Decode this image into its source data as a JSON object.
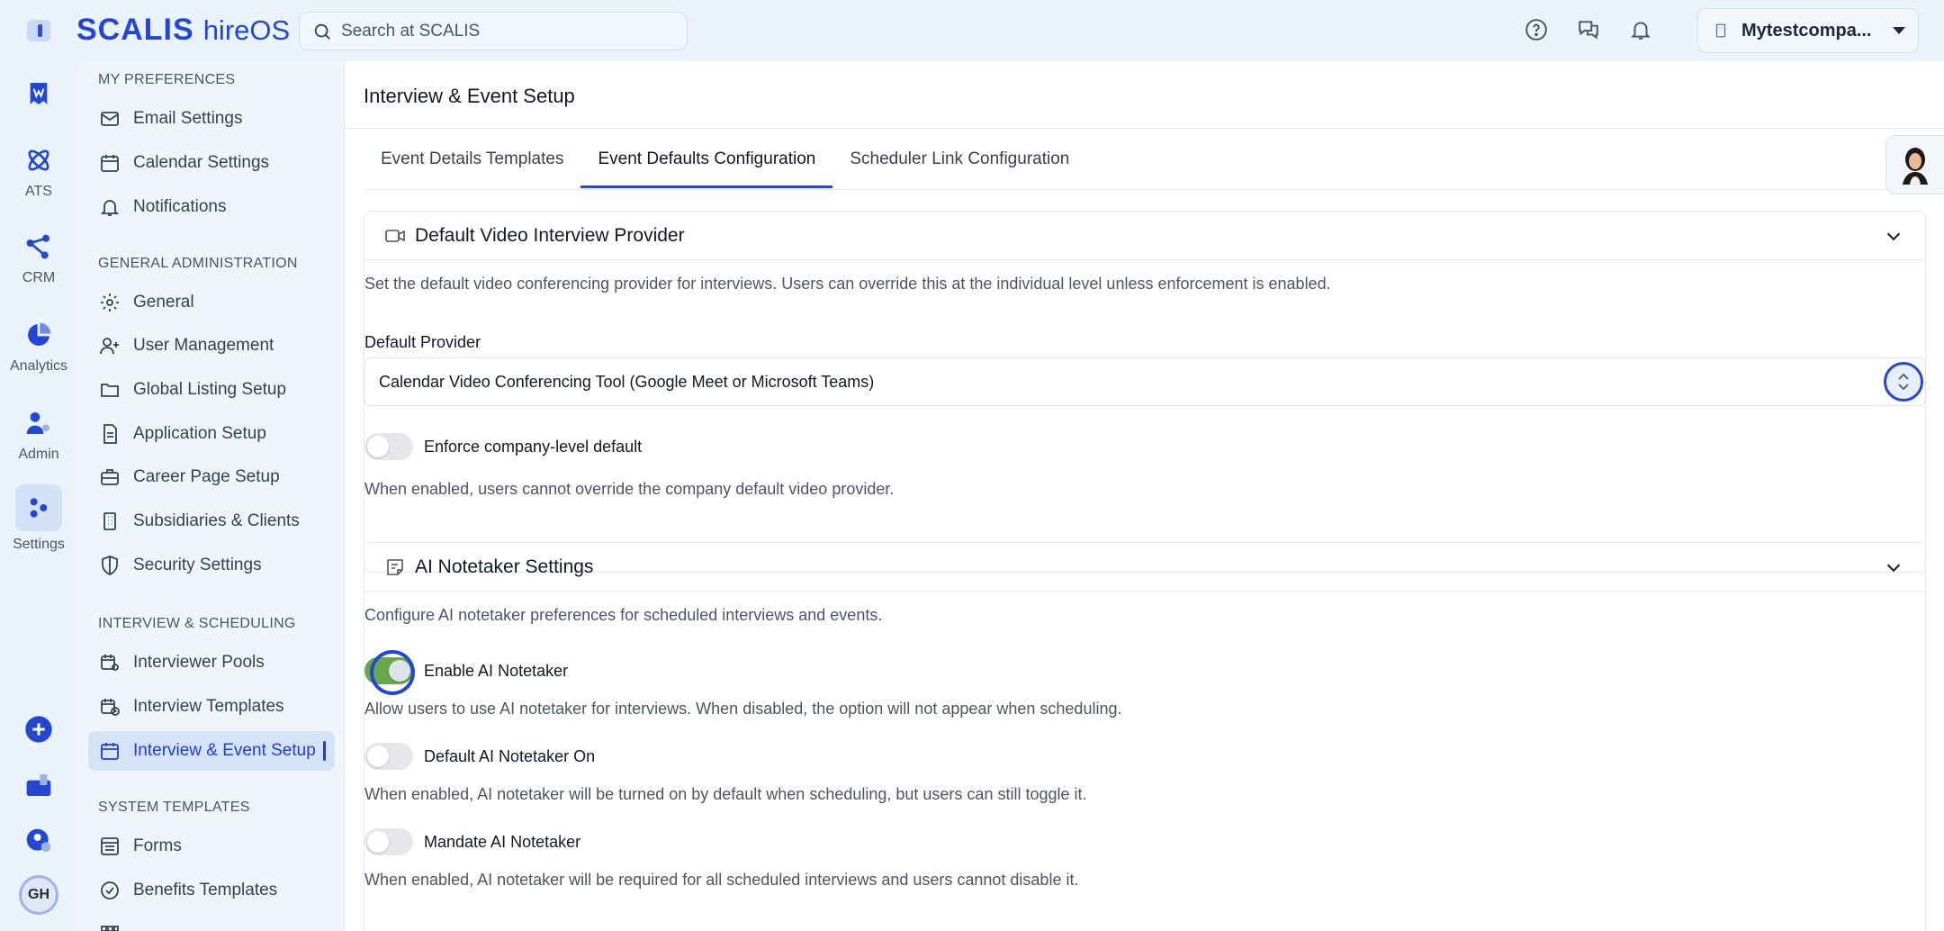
{
  "brand": {
    "name": "SCALIS",
    "product": "hireOS"
  },
  "search": {
    "placeholder": "Search at SCALIS"
  },
  "company": {
    "name": "Mytestcompa..."
  },
  "rail": {
    "items": [
      {
        "label": ""
      },
      {
        "label": "ATS"
      },
      {
        "label": "CRM"
      },
      {
        "label": "Analytics"
      },
      {
        "label": "Admin"
      },
      {
        "label": "Settings"
      }
    ],
    "avatar_initials": "GH"
  },
  "nav": {
    "sections": [
      {
        "title": "MY PREFERENCES",
        "items": [
          "Email Settings",
          "Calendar Settings",
          "Notifications"
        ]
      },
      {
        "title": "GENERAL ADMINISTRATION",
        "items": [
          "General",
          "User Management",
          "Global Listing Setup",
          "Application Setup",
          "Career Page Setup",
          "Subsidiaries & Clients",
          "Security Settings"
        ]
      },
      {
        "title": "INTERVIEW & SCHEDULING",
        "items": [
          "Interviewer Pools",
          "Interview Templates",
          "Interview & Event Setup"
        ]
      },
      {
        "title": "SYSTEM TEMPLATES",
        "items": [
          "Forms",
          "Benefits Templates"
        ]
      }
    ],
    "active": "Interview & Event Setup"
  },
  "main": {
    "title": "Interview & Event Setup",
    "tabs": [
      {
        "label": "Event Details Templates",
        "active": false
      },
      {
        "label": "Event Defaults Configuration",
        "active": true
      },
      {
        "label": "Scheduler Link Configuration",
        "active": false
      }
    ]
  },
  "video_card": {
    "title": "Default Video Interview Provider",
    "description": "Set the default video conferencing provider for interviews. Users can override this at the individual level unless enforcement is enabled.",
    "provider_label": "Default Provider",
    "provider_value": "Calendar Video Conferencing Tool (Google Meet or Microsoft Teams)",
    "enforce_label": "Enforce company-level default",
    "enforce_on": false,
    "enforce_description": "When enabled, users cannot override the company default video provider."
  },
  "ai_card": {
    "title": "AI Notetaker Settings",
    "description": "Configure AI notetaker preferences for scheduled interviews and events.",
    "enable_label": "Enable AI Notetaker",
    "enable_on": true,
    "enable_description": "Allow users to use AI notetaker for interviews. When disabled, the option will not appear when scheduling.",
    "default_label": "Default AI Notetaker On",
    "default_on": false,
    "default_description": "When enabled, AI notetaker will be turned on by default when scheduling, but users can still toggle it.",
    "mandate_label": "Mandate AI Notetaker",
    "mandate_on": false,
    "mandate_description": "When enabled, AI notetaker will be required for all scheduled interviews and users cannot disable it."
  },
  "colors": {
    "brand": "#2346d3",
    "toggle_on": "#6aa84f",
    "active_nav_bg": "#d5e3f8"
  }
}
